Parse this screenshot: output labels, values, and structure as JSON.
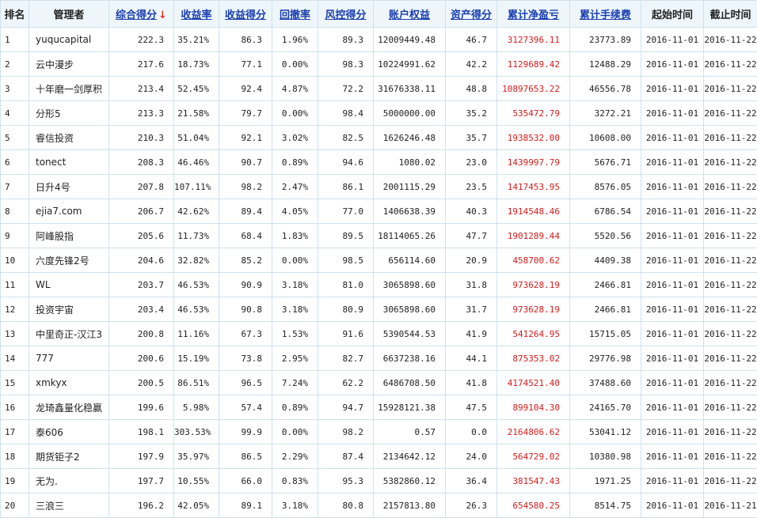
{
  "table": {
    "headers": [
      {
        "label": "排名",
        "sortable": false
      },
      {
        "label": "管理者",
        "sortable": false
      },
      {
        "label": "综合得分",
        "sortable": true,
        "sorted": true,
        "arrow": "↓"
      },
      {
        "label": "收益率",
        "sortable": true
      },
      {
        "label": "收益得分",
        "sortable": true
      },
      {
        "label": "回撤率",
        "sortable": true
      },
      {
        "label": "风控得分",
        "sortable": true
      },
      {
        "label": "账户权益",
        "sortable": true
      },
      {
        "label": "资产得分",
        "sortable": true
      },
      {
        "label": "累计净盈亏",
        "sortable": true
      },
      {
        "label": "累计手续费",
        "sortable": true
      },
      {
        "label": "起始时间",
        "sortable": false
      },
      {
        "label": "截止时间",
        "sortable": false
      }
    ],
    "rows": [
      [
        "1",
        "yuqucapital",
        "222.3",
        "35.21%",
        "86.3",
        "1.96%",
        "89.3",
        "12009449.48",
        "46.7",
        "3127396.11",
        "23773.89",
        "2016-11-01",
        "2016-11-22"
      ],
      [
        "2",
        "云中漫步",
        "217.6",
        "18.73%",
        "77.1",
        "0.00%",
        "98.3",
        "10224991.62",
        "42.2",
        "1129689.42",
        "12488.29",
        "2016-11-01",
        "2016-11-22"
      ],
      [
        "3",
        "十年磨一剑厚积",
        "213.4",
        "52.45%",
        "92.4",
        "4.87%",
        "72.2",
        "31676338.11",
        "48.8",
        "10897653.22",
        "46556.78",
        "2016-11-01",
        "2016-11-22"
      ],
      [
        "4",
        "分形5",
        "213.3",
        "21.58%",
        "79.7",
        "0.00%",
        "98.4",
        "5000000.00",
        "35.2",
        "535472.79",
        "3272.21",
        "2016-11-01",
        "2016-11-22"
      ],
      [
        "5",
        "睿信投资",
        "210.3",
        "51.04%",
        "92.1",
        "3.02%",
        "82.5",
        "1626246.48",
        "35.7",
        "1938532.00",
        "10608.00",
        "2016-11-01",
        "2016-11-22"
      ],
      [
        "6",
        "tonect",
        "208.3",
        "46.46%",
        "90.7",
        "0.89%",
        "94.6",
        "1080.02",
        "23.0",
        "1439997.79",
        "5676.71",
        "2016-11-01",
        "2016-11-22"
      ],
      [
        "7",
        "日升4号",
        "207.8",
        "107.11%",
        "98.2",
        "2.47%",
        "86.1",
        "2001115.29",
        "23.5",
        "1417453.95",
        "8576.05",
        "2016-11-01",
        "2016-11-22"
      ],
      [
        "8",
        "ejia7.com",
        "206.7",
        "42.62%",
        "89.4",
        "4.05%",
        "77.0",
        "1406638.39",
        "40.3",
        "1914548.46",
        "6786.54",
        "2016-11-01",
        "2016-11-22"
      ],
      [
        "9",
        "阿峰股指",
        "205.6",
        "11.73%",
        "68.4",
        "1.83%",
        "89.5",
        "18114065.26",
        "47.7",
        "1901289.44",
        "5520.56",
        "2016-11-01",
        "2016-11-22"
      ],
      [
        "10",
        "六度先锋2号",
        "204.6",
        "32.82%",
        "85.2",
        "0.00%",
        "98.5",
        "656114.60",
        "20.9",
        "458700.62",
        "4409.38",
        "2016-11-01",
        "2016-11-22"
      ],
      [
        "11",
        "WL",
        "203.7",
        "46.53%",
        "90.9",
        "3.18%",
        "81.0",
        "3065898.60",
        "31.8",
        "973628.19",
        "2466.81",
        "2016-11-01",
        "2016-11-22"
      ],
      [
        "12",
        "投资宇宙",
        "203.4",
        "46.53%",
        "90.8",
        "3.18%",
        "80.9",
        "3065898.60",
        "31.7",
        "973628.19",
        "2466.81",
        "2016-11-01",
        "2016-11-22"
      ],
      [
        "13",
        "中里奇正-汉江3",
        "200.8",
        "11.16%",
        "67.3",
        "1.53%",
        "91.6",
        "5390544.53",
        "41.9",
        "541264.95",
        "15715.05",
        "2016-11-01",
        "2016-11-22"
      ],
      [
        "14",
        "777",
        "200.6",
        "15.19%",
        "73.8",
        "2.95%",
        "82.7",
        "6637238.16",
        "44.1",
        "875353.02",
        "29776.98",
        "2016-11-01",
        "2016-11-22"
      ],
      [
        "15",
        "xmkyx",
        "200.5",
        "86.51%",
        "96.5",
        "7.24%",
        "62.2",
        "6486708.50",
        "41.8",
        "4174521.40",
        "37488.60",
        "2016-11-01",
        "2016-11-22"
      ],
      [
        "16",
        "龙琦鑫量化稳赢",
        "199.6",
        "5.98%",
        "57.4",
        "0.89%",
        "94.7",
        "15928121.38",
        "47.5",
        "899104.30",
        "24165.70",
        "2016-11-01",
        "2016-11-22"
      ],
      [
        "17",
        "泰606",
        "198.1",
        "303.53%",
        "99.9",
        "0.00%",
        "98.2",
        "0.57",
        "0.0",
        "2164806.62",
        "53041.12",
        "2016-11-01",
        "2016-11-22"
      ],
      [
        "18",
        "期货钜子2",
        "197.9",
        "35.97%",
        "86.5",
        "2.29%",
        "87.4",
        "2134642.12",
        "24.0",
        "564729.02",
        "10380.98",
        "2016-11-01",
        "2016-11-22"
      ],
      [
        "19",
        "无为.",
        "197.7",
        "10.55%",
        "66.0",
        "0.83%",
        "95.3",
        "5382860.12",
        "36.4",
        "381547.43",
        "1971.25",
        "2016-11-01",
        "2016-11-22"
      ],
      [
        "20",
        "三浪三",
        "196.2",
        "42.05%",
        "89.1",
        "3.18%",
        "80.8",
        "2157813.80",
        "26.3",
        "654580.25",
        "8514.75",
        "2016-11-01",
        "2016-11-21"
      ]
    ]
  },
  "colors": {
    "header_bg": "#eef6fb",
    "border": "#cfe2ee",
    "link": "#1a3fb0",
    "sort_arrow": "#e53322",
    "profit": "#d71a1a"
  }
}
